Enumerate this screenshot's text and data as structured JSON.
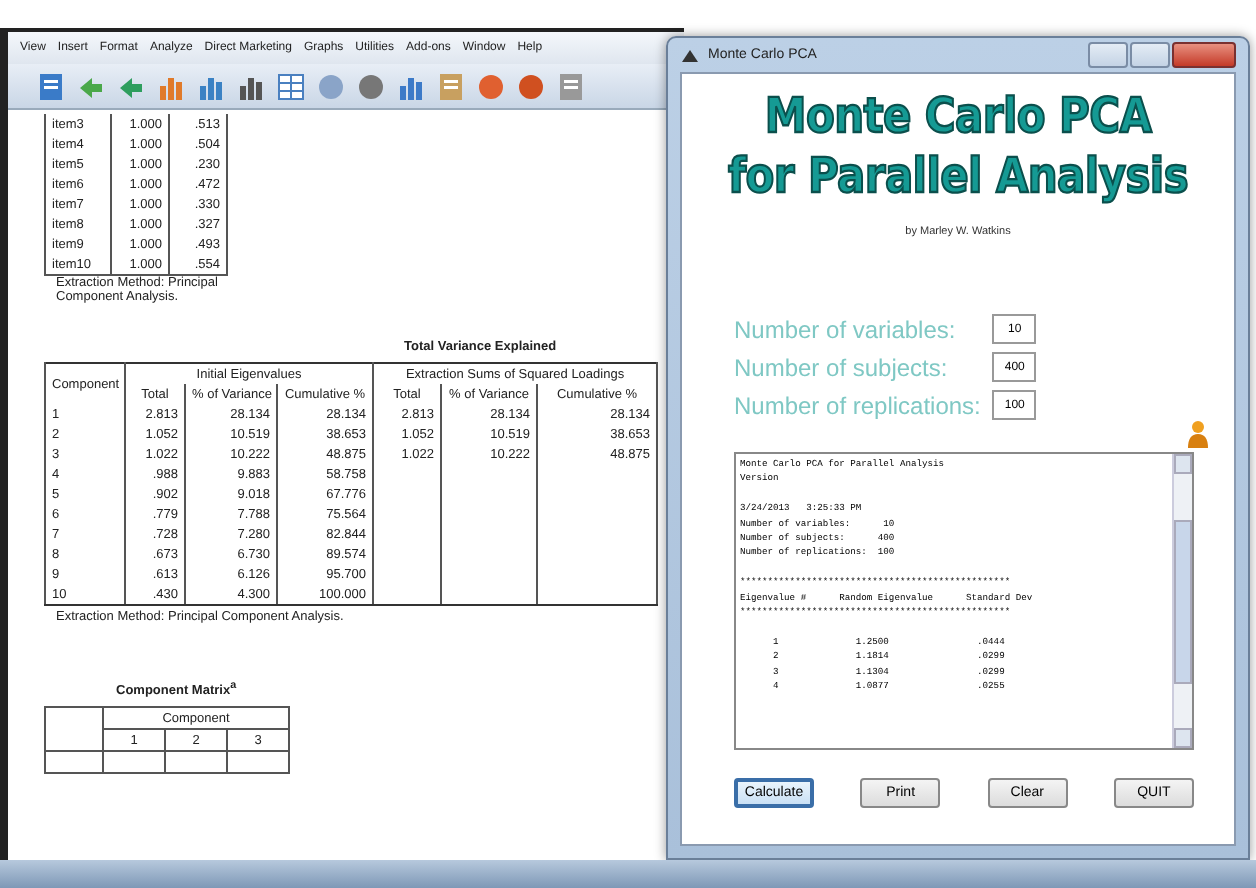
{
  "spss": {
    "menu": [
      "View",
      "Insert",
      "Format",
      "Analyze",
      "Direct Marketing",
      "Graphs",
      "Utilities",
      "Add-ons",
      "Window",
      "Help"
    ],
    "communalities": {
      "rows": [
        {
          "item": "item3",
          "initial": "1.000",
          "extraction": ".513"
        },
        {
          "item": "item4",
          "initial": "1.000",
          "extraction": ".504"
        },
        {
          "item": "item5",
          "initial": "1.000",
          "extraction": ".230"
        },
        {
          "item": "item6",
          "initial": "1.000",
          "extraction": ".472"
        },
        {
          "item": "item7",
          "initial": "1.000",
          "extraction": ".330"
        },
        {
          "item": "item8",
          "initial": "1.000",
          "extraction": ".327"
        },
        {
          "item": "item9",
          "initial": "1.000",
          "extraction": ".493"
        },
        {
          "item": "item10",
          "initial": "1.000",
          "extraction": ".554"
        }
      ],
      "footnote": [
        "Extraction Method: Principal",
        "Component Analysis."
      ]
    },
    "variance": {
      "title": "Total Variance Explained",
      "corner": "Component",
      "groups": [
        "Initial Eigenvalues",
        "Extraction Sums of Squared Loadings"
      ],
      "columns": [
        "Total",
        "% of Variance",
        "Cumulative %",
        "Total",
        "% of Variance",
        "Cumulative %"
      ],
      "rows": [
        {
          "component": "1",
          "initial": [
            "2.813",
            "28.134",
            "28.134"
          ],
          "extraction": [
            "2.813",
            "28.134",
            "28.134"
          ]
        },
        {
          "component": "2",
          "initial": [
            "1.052",
            "10.519",
            "38.653"
          ],
          "extraction": [
            "1.052",
            "10.519",
            "38.653"
          ]
        },
        {
          "component": "3",
          "initial": [
            "1.022",
            "10.222",
            "48.875"
          ],
          "extraction": [
            "1.022",
            "10.222",
            "48.875"
          ]
        },
        {
          "component": "4",
          "initial": [
            ".988",
            "9.883",
            "58.758"
          ]
        },
        {
          "component": "5",
          "initial": [
            ".902",
            "9.018",
            "67.776"
          ]
        },
        {
          "component": "6",
          "initial": [
            ".779",
            "7.788",
            "75.564"
          ]
        },
        {
          "component": "7",
          "initial": [
            ".728",
            "7.280",
            "82.844"
          ]
        },
        {
          "component": "8",
          "initial": [
            ".673",
            "6.730",
            "89.574"
          ]
        },
        {
          "component": "9",
          "initial": [
            ".613",
            "6.126",
            "95.700"
          ]
        },
        {
          "component": "10",
          "initial": [
            ".430",
            "4.300",
            "100.000"
          ]
        }
      ],
      "footnote": "Extraction Method: Principal Component Analysis."
    },
    "component_matrix": {
      "title": "Component Matrix$^{a}$",
      "group": "Component",
      "columns": [
        "1",
        "2",
        "3"
      ]
    }
  },
  "dialog": {
    "title": "Monte Carlo PCA",
    "headline": [
      "Monte Carlo PCA",
      "for Parallel Analysis"
    ],
    "byline": "by Marley W. Watkins",
    "fields": [
      {
        "label": "Number of variables:",
        "value": "10"
      },
      {
        "label": "Number of subjects:",
        "value": "400"
      },
      {
        "label": "Number of replications:",
        "value": "100"
      }
    ],
    "output": [
      [
        "Monte Carlo PCA for Parallel Analysis",
        "Version"
      ],
      [
        "3/24/2013   3:25:33 PM",
        "Number of variables:      10",
        "Number of subjects:      400",
        "Number of replications:  100"
      ],
      [
        "*************************************************",
        "Eigenvalue #      Random Eigenvalue      Standard Dev",
        "*************************************************"
      ],
      [
        "      1              1.2500                .0444",
        "      2              1.1814                .0299",
        "      3              1.1304                .0299",
        "      4              1.0877                .0255"
      ]
    ],
    "buttons": [
      {
        "label": "Calculate",
        "selected": true
      },
      {
        "label": "Print",
        "selected": false
      },
      {
        "label": "Clear",
        "selected": false
      },
      {
        "label": "QUIT",
        "selected": false
      }
    ]
  }
}
